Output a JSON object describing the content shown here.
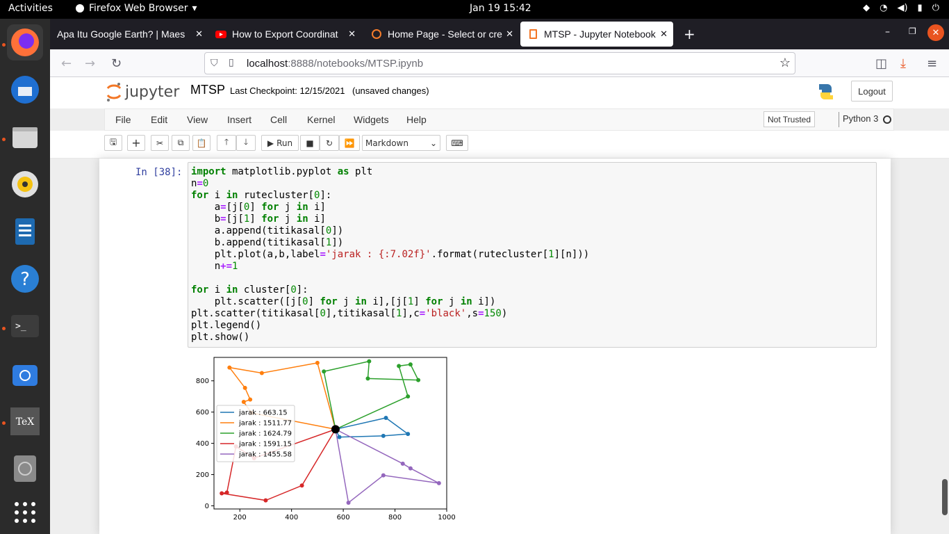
{
  "topbar": {
    "activities": "Activities",
    "app_name": "Firefox Web Browser",
    "clock": "Jan 19  15:42"
  },
  "browser": {
    "tabs": [
      {
        "label": "Apa Itu Google Earth? | Maes"
      },
      {
        "label": "How to Export Coordinat"
      },
      {
        "label": "Home Page - Select or cre"
      },
      {
        "label": "MTSP - Jupyter Notebook"
      }
    ],
    "url_host": "localhost",
    "url_rest": ":8888/notebooks/MTSP.ipynb"
  },
  "jupyter": {
    "logo_text": "jupyter",
    "notebook_name": "MTSP",
    "checkpoint": "Last Checkpoint: 12/15/2021",
    "unsaved": "(unsaved changes)",
    "logout": "Logout",
    "menu": [
      "File",
      "Edit",
      "View",
      "Insert",
      "Cell",
      "Kernel",
      "Widgets",
      "Help"
    ],
    "not_trusted": "Not Trusted",
    "kernel": "Python 3",
    "run_label": "Run",
    "cell_type": "Markdown",
    "prompt": "In [38]:"
  },
  "chart_data": {
    "type": "line",
    "xlim": [
      100,
      1000
    ],
    "ylim": [
      -20,
      950
    ],
    "xticks": [
      "200",
      "400",
      "600",
      "800",
      "1000"
    ],
    "yticks": [
      "0",
      "200",
      "400",
      "600",
      "800"
    ],
    "legend_position": "center-left",
    "depot": [
      570,
      490
    ],
    "series": [
      {
        "name": "jarak :  663.15",
        "color": "#1f77b4",
        "points": [
          [
            570,
            490
          ],
          [
            765,
            563
          ],
          [
            850,
            460
          ],
          [
            755,
            448
          ],
          [
            585,
            440
          ],
          [
            570,
            490
          ]
        ]
      },
      {
        "name": "jarak : 1511.77",
        "color": "#ff7f0e",
        "points": [
          [
            570,
            490
          ],
          [
            500,
            915
          ],
          [
            285,
            850
          ],
          [
            160,
            885
          ],
          [
            220,
            755
          ],
          [
            240,
            680
          ],
          [
            215,
            665
          ],
          [
            245,
            595
          ],
          [
            570,
            490
          ]
        ]
      },
      {
        "name": "jarak : 1624.79",
        "color": "#2ca02c",
        "points": [
          [
            570,
            490
          ],
          [
            525,
            860
          ],
          [
            700,
            925
          ],
          [
            695,
            815
          ],
          [
            890,
            805
          ],
          [
            860,
            905
          ],
          [
            815,
            895
          ],
          [
            850,
            700
          ],
          [
            570,
            490
          ]
        ]
      },
      {
        "name": "jarak : 1591.15",
        "color": "#d62728",
        "points": [
          [
            570,
            490
          ],
          [
            255,
            305
          ],
          [
            185,
            380
          ],
          [
            150,
            85
          ],
          [
            130,
            80
          ],
          [
            300,
            35
          ],
          [
            440,
            130
          ],
          [
            570,
            490
          ]
        ]
      },
      {
        "name": "jarak : 1455.58",
        "color": "#9467bd",
        "points": [
          [
            570,
            490
          ],
          [
            620,
            20
          ],
          [
            755,
            195
          ],
          [
            970,
            145
          ],
          [
            860,
            240
          ],
          [
            830,
            270
          ],
          [
            570,
            490
          ]
        ]
      }
    ]
  }
}
